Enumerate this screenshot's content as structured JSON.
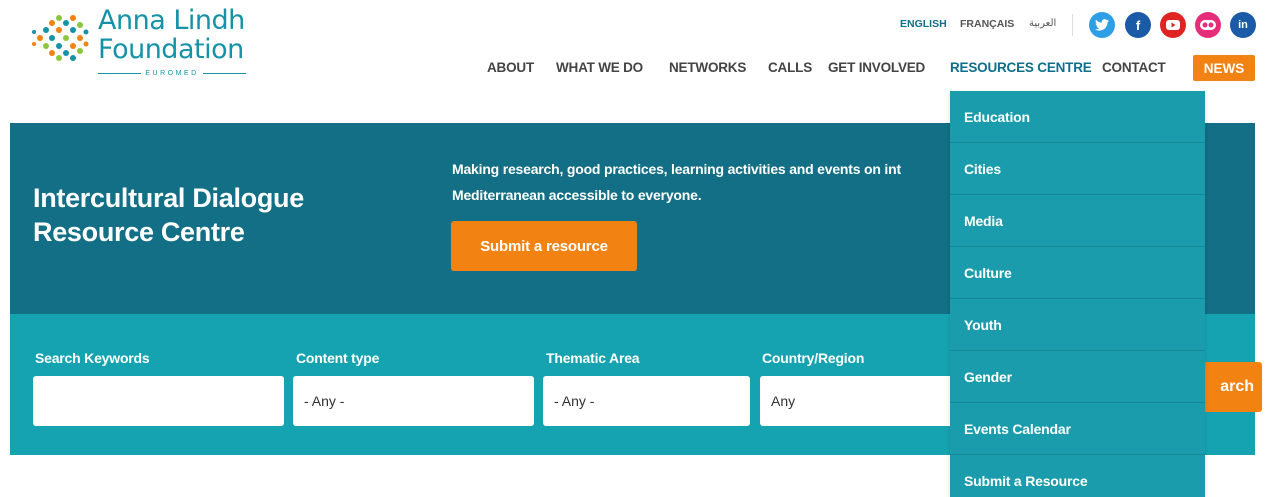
{
  "header": {
    "logo": {
      "line1": "Anna Lindh",
      "line2": "Foundation",
      "sub": "EUROMED"
    },
    "languages": [
      "ENGLISH",
      "FRANÇAIS",
      "العربية"
    ],
    "social": [
      {
        "icon": "twitter-icon",
        "glyph": "🐦"
      },
      {
        "icon": "facebook-icon",
        "glyph": "f"
      },
      {
        "icon": "youtube-icon",
        "glyph": "▶"
      },
      {
        "icon": "flickr-icon",
        "glyph": "●●"
      },
      {
        "icon": "linkedin-icon",
        "glyph": "in"
      }
    ],
    "nav": [
      "ABOUT",
      "WHAT WE DO",
      "NETWORKS",
      "CALLS",
      "GET INVOLVED",
      "RESOURCES CENTRE",
      "CONTACT"
    ],
    "news_label": "NEWS"
  },
  "hero": {
    "title": "Intercultural Dialogue Resource Centre",
    "description_line1": "Making research, good practices, learning activities and events on int",
    "description_line2": "Mediterranean accessible to everyone.",
    "submit_label": "Submit a resource"
  },
  "search": {
    "keywords_label": "Search Keywords",
    "keywords_value": "",
    "content_type_label": "Content type",
    "content_type_value": "- Any -",
    "thematic_label": "Thematic Area",
    "thematic_value": "- Any -",
    "country_label": "Country/Region",
    "country_value": "Any",
    "search_button_label": "arch"
  },
  "dropdown": {
    "items": [
      "Education",
      "Cities",
      "Media",
      "Culture",
      "Youth",
      "Gender",
      "Events Calendar",
      "Submit a Resource"
    ]
  },
  "colors": {
    "teal_dark": "#136f85",
    "teal_light": "#16a3b1",
    "dropdown": "#1a9cad",
    "orange": "#f28212",
    "logo": "#1592a8"
  }
}
